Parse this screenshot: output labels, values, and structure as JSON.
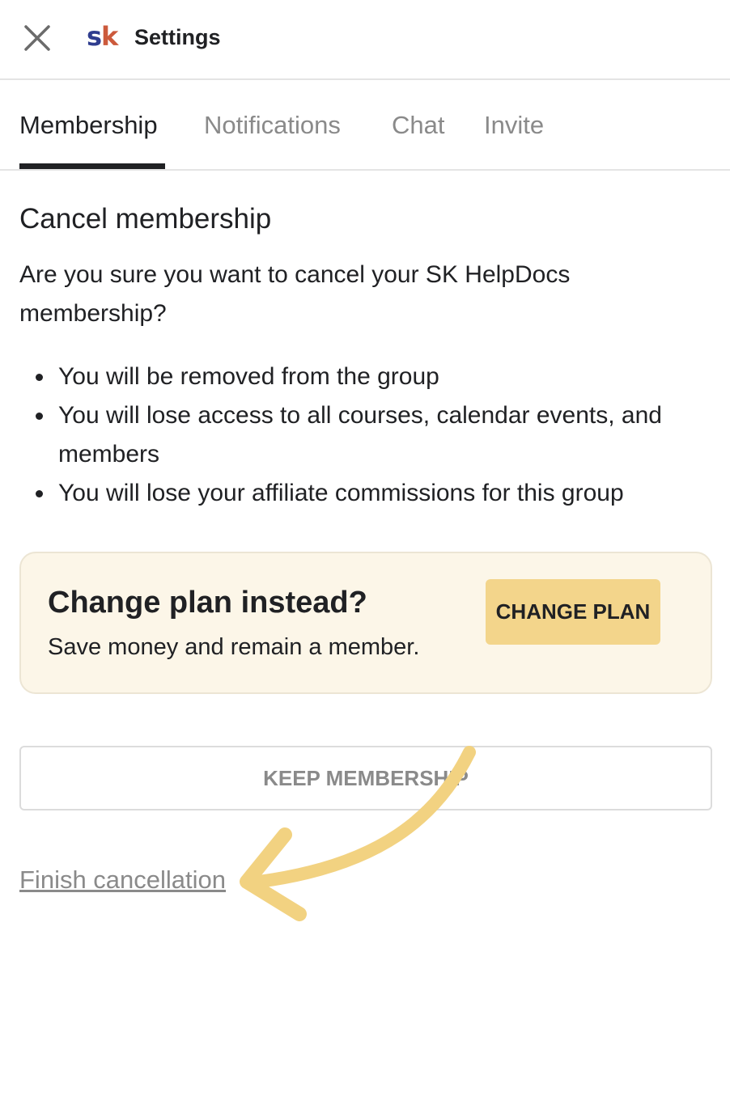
{
  "header": {
    "close_icon": "close-icon",
    "logo": {
      "s": "s",
      "k": "k"
    },
    "title": "Settings"
  },
  "tabs": [
    {
      "label": "Membership",
      "active": true
    },
    {
      "label": "Notifications",
      "active": false
    },
    {
      "label": "Chat",
      "active": false
    },
    {
      "label": "Invite",
      "active": false
    }
  ],
  "main": {
    "heading": "Cancel membership",
    "question": "Are you sure you want to cancel your SK HelpDocs membership?",
    "bullets": [
      "You will be removed from the group",
      "You will lose access to all courses, calendar events, and members",
      "You will lose your affiliate commissions for this group"
    ]
  },
  "plan_card": {
    "title": "Change plan instead?",
    "subtitle": "Save money and remain a member.",
    "button_label": "CHANGE PLAN"
  },
  "keep_button_label": "KEEP MEMBERSHIP",
  "finish_link": "Finish cancellation",
  "colors": {
    "accent_yellow": "#f3d58b",
    "card_bg": "#fcf6e8",
    "arrow": "#f2d281",
    "logo_s": "#2f3d8f",
    "logo_k": "#cc5a3c"
  }
}
